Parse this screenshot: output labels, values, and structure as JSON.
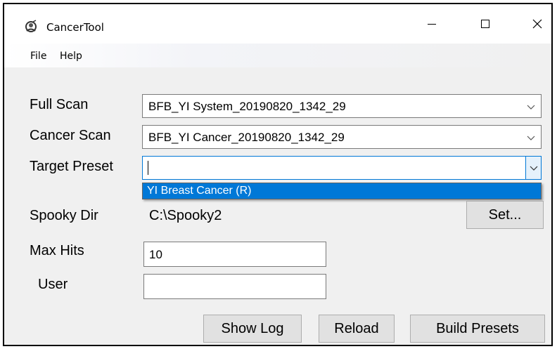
{
  "window": {
    "title": "CancerTool",
    "minimize_icon": "minimize-icon",
    "maximize_icon": "maximize-icon",
    "close_icon": "close-icon",
    "app_icon": "app-icon"
  },
  "menu": {
    "items": [
      {
        "label": "File"
      },
      {
        "label": "Help"
      }
    ]
  },
  "form": {
    "full_scan": {
      "label": "Full Scan",
      "value": "BFB_YI System_20190820_1342_29"
    },
    "cancer_scan": {
      "label": "Cancer Scan",
      "value": "BFB_YI Cancer_20190820_1342_29"
    },
    "target_preset": {
      "label": "Target Preset",
      "value": "",
      "dropdown_options": [
        "YI Breast Cancer (R)"
      ]
    },
    "spooky_dir": {
      "label": "Spooky Dir",
      "value": "C:\\Spooky2",
      "set_button": "Set..."
    },
    "max_hits": {
      "label": "Max Hits",
      "value": "10"
    },
    "user": {
      "label": "User",
      "value": ""
    }
  },
  "buttons": {
    "show_log": "Show Log",
    "reload": "Reload",
    "build_presets": "Build Presets"
  },
  "colors": {
    "accent": "#0078d7",
    "window_bg": "#f0f0f0",
    "button_bg": "#e1e1e1"
  }
}
